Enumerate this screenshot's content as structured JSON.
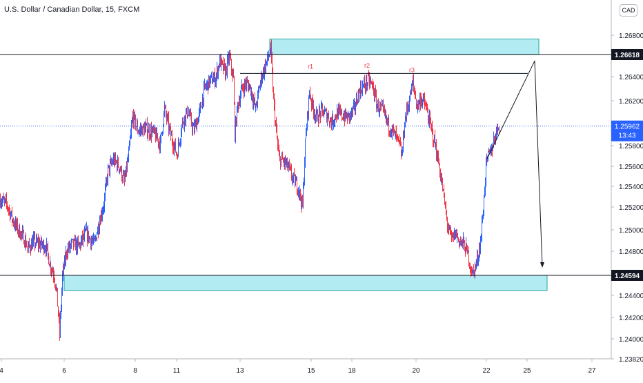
{
  "chart_title": "U.S. Dollar / Canadian Dollar, 15, FXCM",
  "currency_button": "CAD",
  "current_price": {
    "value": "1.25962",
    "countdown": "13:43"
  },
  "chart_data": {
    "type": "candlestick",
    "title": "U.S. Dollar / Canadian Dollar, 15, FXCM",
    "currency": "CAD",
    "yticks": [
      "1.26800",
      "1.26400",
      "1.26200",
      "1.25800",
      "1.25600",
      "1.25400",
      "1.25200",
      "1.25000",
      "1.24800",
      "1.24400",
      "1.24200",
      "1.24000",
      "1.23820"
    ],
    "xticks": [
      "4",
      "6",
      "8",
      "11",
      "13",
      "15",
      "18",
      "20",
      "22",
      "25",
      "27"
    ],
    "ylim": [
      1.2382,
      1.2693
    ],
    "price_path": [
      [
        0,
        1.2529
      ],
      [
        10,
        1.2524
      ],
      [
        18,
        1.251
      ],
      [
        26,
        1.2501
      ],
      [
        34,
        1.2494
      ],
      [
        40,
        1.2484
      ],
      [
        48,
        1.249
      ],
      [
        58,
        1.2488
      ],
      [
        66,
        1.2486
      ],
      [
        72,
        1.247
      ],
      [
        78,
        1.246
      ],
      [
        82,
        1.2442
      ],
      [
        86,
        1.2406
      ],
      [
        90,
        1.2458
      ],
      [
        96,
        1.2482
      ],
      [
        104,
        1.2488
      ],
      [
        114,
        1.2486
      ],
      [
        124,
        1.2498
      ],
      [
        136,
        1.2488
      ],
      [
        144,
        1.251
      ],
      [
        150,
        1.2525
      ],
      [
        156,
        1.2555
      ],
      [
        164,
        1.2565
      ],
      [
        172,
        1.256
      ],
      [
        180,
        1.2545
      ],
      [
        186,
        1.257
      ],
      [
        192,
        1.2605
      ],
      [
        200,
        1.2592
      ],
      [
        210,
        1.2594
      ],
      [
        222,
        1.259
      ],
      [
        232,
        1.258
      ],
      [
        238,
        1.2612
      ],
      [
        246,
        1.259
      ],
      [
        256,
        1.257
      ],
      [
        264,
        1.26
      ],
      [
        272,
        1.261
      ],
      [
        280,
        1.2592
      ],
      [
        288,
        1.2606
      ],
      [
        296,
        1.263
      ],
      [
        304,
        1.2638
      ],
      [
        312,
        1.264
      ],
      [
        318,
        1.2656
      ],
      [
        326,
        1.2645
      ],
      [
        332,
        1.266
      ],
      [
        338,
        1.2638
      ],
      [
        340,
        1.259
      ],
      [
        344,
        1.2615
      ],
      [
        350,
        1.263
      ],
      [
        356,
        1.2635
      ],
      [
        362,
        1.2632
      ],
      [
        370,
        1.2612
      ],
      [
        378,
        1.264
      ],
      [
        386,
        1.2655
      ],
      [
        392,
        1.2666
      ],
      [
        396,
        1.262
      ],
      [
        400,
        1.259
      ],
      [
        404,
        1.2566
      ],
      [
        410,
        1.2564
      ],
      [
        416,
        1.256
      ],
      [
        424,
        1.2548
      ],
      [
        432,
        1.254
      ],
      [
        438,
        1.2522
      ],
      [
        442,
        1.258
      ],
      [
        448,
        1.2628
      ],
      [
        452,
        1.2616
      ],
      [
        458,
        1.2604
      ],
      [
        466,
        1.261
      ],
      [
        474,
        1.2606
      ],
      [
        480,
        1.26
      ],
      [
        488,
        1.2608
      ],
      [
        496,
        1.2606
      ],
      [
        504,
        1.2604
      ],
      [
        512,
        1.261
      ],
      [
        520,
        1.2628
      ],
      [
        528,
        1.2634
      ],
      [
        534,
        1.2638
      ],
      [
        540,
        1.2632
      ],
      [
        546,
        1.2615
      ],
      [
        554,
        1.261
      ],
      [
        562,
        1.2598
      ],
      [
        570,
        1.259
      ],
      [
        578,
        1.258
      ],
      [
        582,
        1.2568
      ],
      [
        586,
        1.26
      ],
      [
        592,
        1.2618
      ],
      [
        598,
        1.2636
      ],
      [
        604,
        1.2614
      ],
      [
        610,
        1.2622
      ],
      [
        616,
        1.2615
      ],
      [
        622,
        1.26
      ],
      [
        630,
        1.258
      ],
      [
        636,
        1.256
      ],
      [
        642,
        1.2535
      ],
      [
        648,
        1.2506
      ],
      [
        654,
        1.2492
      ],
      [
        660,
        1.2498
      ],
      [
        666,
        1.249
      ],
      [
        672,
        1.2488
      ],
      [
        678,
        1.2478
      ],
      [
        684,
        1.246
      ],
      [
        690,
        1.247
      ],
      [
        696,
        1.249
      ],
      [
        700,
        1.252
      ],
      [
        704,
        1.256
      ],
      [
        708,
        1.257
      ],
      [
        712,
        1.2575
      ],
      [
        718,
        1.259
      ],
      [
        724,
        1.26
      ]
    ]
  },
  "levels": [
    {
      "name": "resistance-line",
      "price": 1.26618,
      "label": "1.26618"
    },
    {
      "name": "support-line",
      "price": 1.24594,
      "label": "1.24594"
    }
  ],
  "zones": [
    {
      "name": "resistance-zone",
      "price_top": 1.2676,
      "price_bottom": 1.2662,
      "color": "#b2ebf2",
      "border": "#26a69a"
    },
    {
      "name": "support-zone",
      "price_top": 1.24594,
      "price_bottom": 1.24454,
      "color": "#b2ebf2",
      "border": "#26a69a"
    }
  ],
  "annotations": [
    {
      "name": "r1-label",
      "text": "r1",
      "x": 450,
      "price": 1.2645
    },
    {
      "name": "r2-label",
      "text": "r2",
      "x": 532,
      "price": 1.2646
    },
    {
      "name": "r3-label",
      "text": "r3",
      "x": 597,
      "price": 1.2642
    }
  ],
  "colors": {
    "up": "#2962ff",
    "down": "#f23645",
    "zone_fill": "#b2ebf2",
    "zone_border": "#26a69a",
    "price_marker": "#2962ff",
    "level_marker": "#131722",
    "axis_text": "#131722"
  }
}
